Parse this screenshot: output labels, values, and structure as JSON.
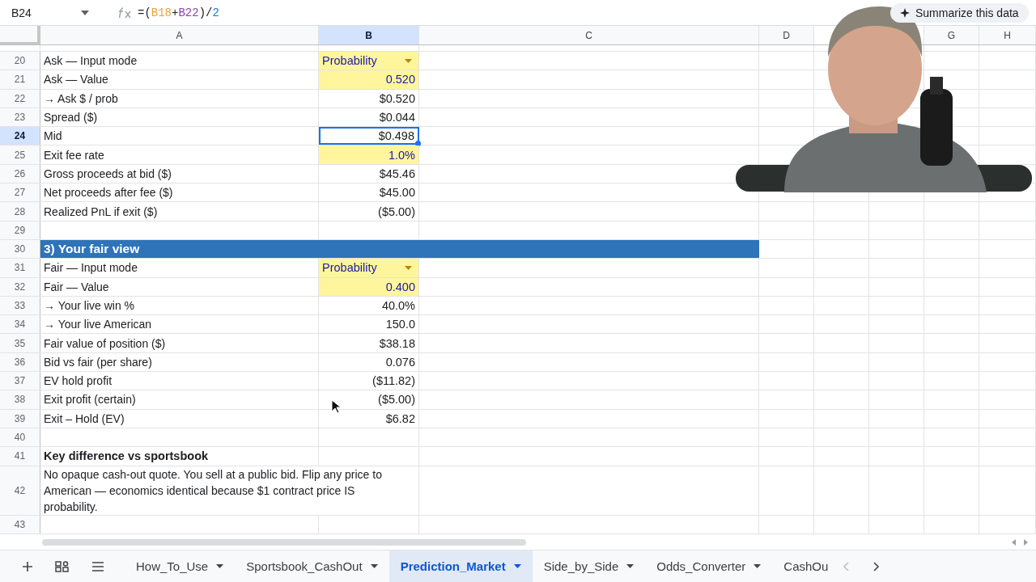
{
  "toolbar": {
    "name_box": "B24",
    "formula": [
      {
        "text": "=("
      },
      {
        "text": "B18",
        "color": "#e8a33d"
      },
      {
        "text": "+"
      },
      {
        "text": "B22",
        "color": "#8e44ad"
      },
      {
        "text": ")/"
      },
      {
        "text": "2",
        "color": "#1a73e8"
      }
    ],
    "summarize_button": "Summarize this data"
  },
  "columns": [
    {
      "label": "A",
      "selected": false
    },
    {
      "label": "B",
      "selected": true
    },
    {
      "label": "C",
      "selected": false
    },
    {
      "label": "D",
      "selected": false
    },
    {
      "label": "G",
      "selected": false
    },
    {
      "label": "H",
      "selected": false
    }
  ],
  "rows": [
    {
      "num": "20",
      "kind": "dropdown",
      "label": "Ask — Input mode",
      "value": "Probability",
      "selected": false
    },
    {
      "num": "21",
      "kind": "input",
      "label": "Ask — Value",
      "value": "0.520",
      "selected": false
    },
    {
      "num": "22",
      "kind": "calc",
      "label": "→ Ask $ / prob",
      "value": "$0.520",
      "selected": false
    },
    {
      "num": "23",
      "kind": "calc",
      "label": "Spread ($)",
      "value": "$0.044",
      "selected": false
    },
    {
      "num": "24",
      "kind": "calc",
      "label": "Mid",
      "value": "$0.498",
      "selected": true
    },
    {
      "num": "25",
      "kind": "input",
      "label": "Exit fee rate",
      "value": "1.0%",
      "selected": false
    },
    {
      "num": "26",
      "kind": "calc",
      "label": "Gross proceeds at bid ($)",
      "value": "$45.46",
      "selected": false
    },
    {
      "num": "27",
      "kind": "calc",
      "label": "Net proceeds after fee ($)",
      "value": "$45.00",
      "selected": false
    },
    {
      "num": "28",
      "kind": "calc",
      "label": "Realized PnL if exit ($)",
      "value": "($5.00)",
      "selected": false
    },
    {
      "num": "29",
      "kind": "empty",
      "selected": false
    },
    {
      "num": "30",
      "kind": "section",
      "label": "3) Your fair view",
      "selected": false
    },
    {
      "num": "31",
      "kind": "dropdown",
      "label": "Fair — Input mode",
      "value": "Probability",
      "selected": false
    },
    {
      "num": "32",
      "kind": "input",
      "label": "Fair — Value",
      "value": "0.400",
      "selected": false
    },
    {
      "num": "33",
      "kind": "calc",
      "label": "→ Your live win %",
      "value": "40.0%",
      "selected": false
    },
    {
      "num": "34",
      "kind": "calc",
      "label": "→ Your live American",
      "value": "150.0",
      "selected": false
    },
    {
      "num": "35",
      "kind": "calc",
      "label": "Fair value of position ($)",
      "value": "$38.18",
      "selected": false
    },
    {
      "num": "36",
      "kind": "calc",
      "label": "Bid vs fair (per share)",
      "value": "0.076",
      "selected": false
    },
    {
      "num": "37",
      "kind": "calc",
      "label": "EV hold profit",
      "value": "($11.82)",
      "selected": false
    },
    {
      "num": "38",
      "kind": "calc",
      "label": "Exit profit (certain)",
      "value": "($5.00)",
      "selected": false
    },
    {
      "num": "39",
      "kind": "calc",
      "label": "Exit – Hold (EV)",
      "value": "$6.82",
      "selected": false
    },
    {
      "num": "40",
      "kind": "empty",
      "selected": false
    },
    {
      "num": "41",
      "kind": "bold",
      "label": "Key difference vs sportsbook",
      "selected": false
    },
    {
      "num": "42",
      "kind": "note",
      "label": "No opaque cash-out quote. You sell at a public bid. Flip any price to American — economics identical because $1 contract price IS probability.",
      "selected": false
    },
    {
      "num": "43",
      "kind": "empty",
      "selected": false
    }
  ],
  "sheet_tabs": [
    {
      "label": "How_To_Use",
      "selected": false
    },
    {
      "label": "Sportsbook_CashOut",
      "selected": false
    },
    {
      "label": "Prediction_Market",
      "selected": true
    },
    {
      "label": "Side_by_Side",
      "selected": false
    },
    {
      "label": "Odds_Converter",
      "selected": false
    },
    {
      "label": "CashOu",
      "selected": false,
      "cut": true
    }
  ]
}
